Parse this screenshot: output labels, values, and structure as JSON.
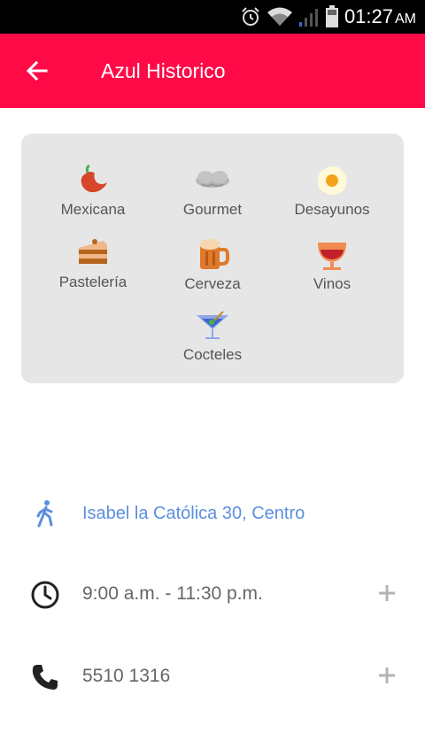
{
  "status_bar": {
    "time": "01:27",
    "ampm": "AM",
    "icons": [
      "alarm-icon",
      "wifi-icon",
      "signal-icon",
      "battery-icon"
    ]
  },
  "app_bar": {
    "title": "Azul Historico",
    "back_icon": "arrow-back-icon",
    "color": "#ff0a47"
  },
  "categories": [
    {
      "label": "Mexicana",
      "icon": "chili-pepper-icon"
    },
    {
      "label": "Gourmet",
      "icon": "chef-hat-icon"
    },
    {
      "label": "Desayunos",
      "icon": "fried-egg-icon"
    },
    {
      "label": "Pastelería",
      "icon": "cake-slice-icon"
    },
    {
      "label": "Cerveza",
      "icon": "beer-mug-icon"
    },
    {
      "label": "Vinos",
      "icon": "wine-glass-icon"
    },
    {
      "label": "Cocteles",
      "icon": "martini-glass-icon"
    }
  ],
  "info": {
    "address": "Isabel la Católica 30, Centro",
    "hours": "9:00 a.m. - 11:30 p.m.",
    "phone": "5510 1316",
    "link_color": "#5b8fdf"
  }
}
